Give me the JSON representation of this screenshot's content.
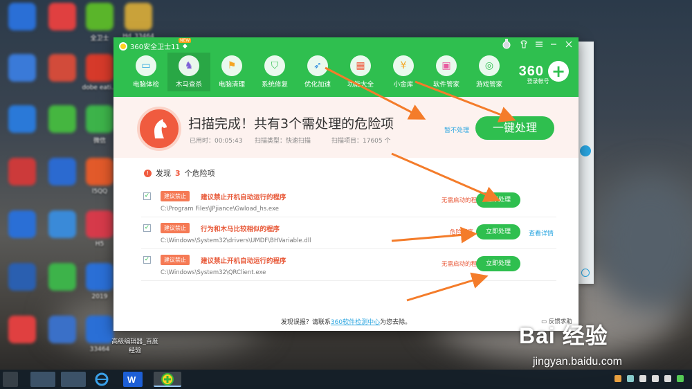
{
  "desktop": {
    "icons": [
      {
        "label": "",
        "color": "#2a6fd6"
      },
      {
        "label": "",
        "color": "#e04040"
      },
      {
        "label": "全卫士",
        "color": "#5ab52a"
      },
      {
        "label": "Hd_33464",
        "color": "#c9a23a"
      },
      {
        "label": "",
        "color": "#3a7ad8"
      },
      {
        "label": "",
        "color": "#d24b3a"
      },
      {
        "label": "dobe eati...",
        "color": "#d63a2a"
      },
      {
        "label": "",
        "color": "#2a79d8"
      },
      {
        "label": "",
        "color": "#45b640"
      },
      {
        "label": "微信",
        "color": "#3db34a"
      },
      {
        "label": "",
        "color": "#cc3a3a"
      },
      {
        "label": "",
        "color": "#2b6ad0"
      },
      {
        "label": "l5QQ",
        "color": "#e25a2a"
      },
      {
        "label": "",
        "color": "#2a6fd6"
      },
      {
        "label": "",
        "color": "#3a8ad8"
      },
      {
        "label": "H5",
        "color": "#d63a4a"
      },
      {
        "label": "",
        "color": "#2a5fb0"
      },
      {
        "label": "",
        "color": "#3db34a"
      },
      {
        "label": "2019",
        "color": "#2a6fd6"
      },
      {
        "label": "",
        "color": "#e04040"
      },
      {
        "label": "",
        "color": "#3a70c8"
      },
      {
        "label": "33464",
        "color": "#2a6fd6"
      }
    ],
    "editor_label": "高级编辑器_百度经验"
  },
  "window": {
    "title": "360安全卫士11",
    "new_badge": "NEW",
    "nav": [
      {
        "label": "电脑体检",
        "icon": "monitor-icon"
      },
      {
        "label": "木马查杀",
        "icon": "horse-icon"
      },
      {
        "label": "电脑清理",
        "icon": "broom-icon"
      },
      {
        "label": "系统修复",
        "icon": "shield-icon"
      },
      {
        "label": "优化加速",
        "icon": "rocket-icon"
      },
      {
        "label": "功能大全",
        "icon": "grid-icon"
      },
      {
        "label": "小金库",
        "icon": "coin-icon"
      },
      {
        "label": "软件管家",
        "icon": "apps-icon"
      },
      {
        "label": "游戏管家",
        "icon": "gamepad-icon"
      }
    ],
    "brand": "360",
    "login": "登录帐号"
  },
  "scan": {
    "title": "扫描完成！共有3个需处理的危险项",
    "time": "已用时：00:05:43",
    "type": "扫描类型：快速扫描",
    "items": "扫描项目：17605 个",
    "skip": "暂不处理",
    "one_key": "一键处理"
  },
  "found": {
    "prefix": "发现",
    "count": "3",
    "suffix": "个危险项"
  },
  "threats": [
    {
      "tag": "建议禁止",
      "name": "建议禁止开机自动运行的程序",
      "path": "C:\\Program Files\\JPjiance\\Gwload_hs.exe",
      "kind": "无需启动的程序",
      "action": "立即处理",
      "detail": ""
    },
    {
      "tag": "建议禁止",
      "name": "行为和木马比较相似的程序",
      "path": "C:\\Windows\\System32\\drivers\\UMDF\\BHVariable.dll",
      "kind": "危险程序",
      "action": "立即处理",
      "detail": "查看详情"
    },
    {
      "tag": "建议禁止",
      "name": "建议禁止开机自动运行的程序",
      "path": "C:\\Windows\\System32\\QRClient.exe",
      "kind": "无需启动的程序",
      "action": "立即处理",
      "detail": ""
    }
  ],
  "footer": {
    "text1": "发现误报？请联系",
    "link": "360软件检测中心",
    "text2": "为您去除。",
    "feedback": "反馈求助"
  },
  "watermark": {
    "main": "Bai 经验",
    "url": "jingyan.baidu.com"
  },
  "colors": {
    "brand_green": "#2fbf4f",
    "danger": "#f05b3f",
    "link": "#2aa5e0",
    "arrow": "#f47c2a"
  }
}
